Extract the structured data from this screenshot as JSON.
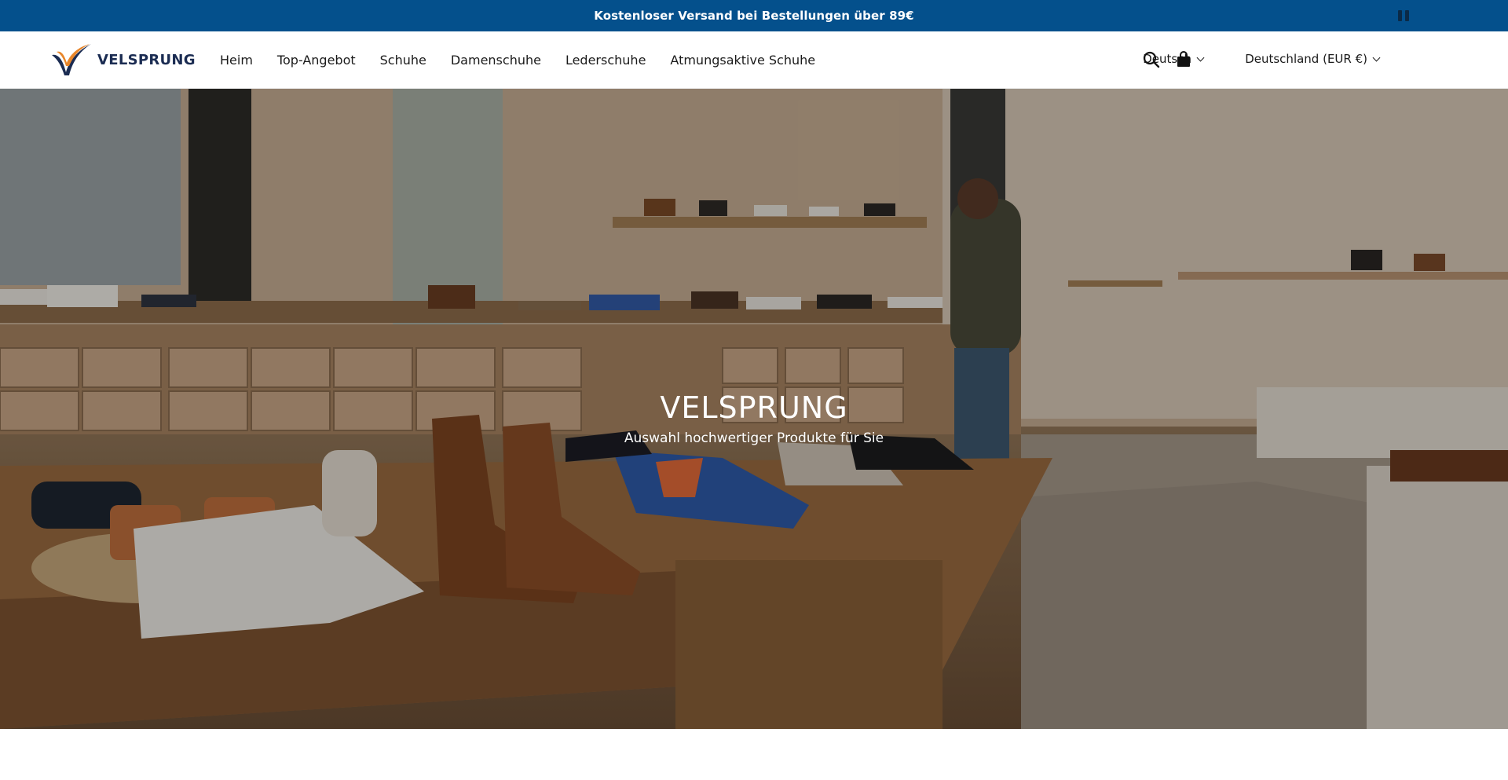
{
  "announcement": {
    "text": "Kostenloser Versand bei Bestellungen über 89€"
  },
  "header": {
    "logo_text": "VELSPRUNG",
    "nav": [
      {
        "label": "Heim"
      },
      {
        "label": "Top-Angebot"
      },
      {
        "label": "Schuhe"
      },
      {
        "label": "Damenschuhe"
      },
      {
        "label": "Lederschuhe"
      },
      {
        "label": "Atmungsaktive Schuhe"
      }
    ],
    "language": "Deutsch",
    "country": "Deutschland (EUR €)",
    "icons": {
      "search": "search-icon",
      "cart": "shopping-bag-icon",
      "pause": "pause-icon"
    }
  },
  "hero": {
    "title": "VELSPRUNG",
    "subtitle": "Auswahl hochwertiger Produkte für Sie"
  },
  "colors": {
    "announcement_bg": "#04508c",
    "brand_navy": "#1b2c52",
    "brand_orange": "#e8862a"
  }
}
